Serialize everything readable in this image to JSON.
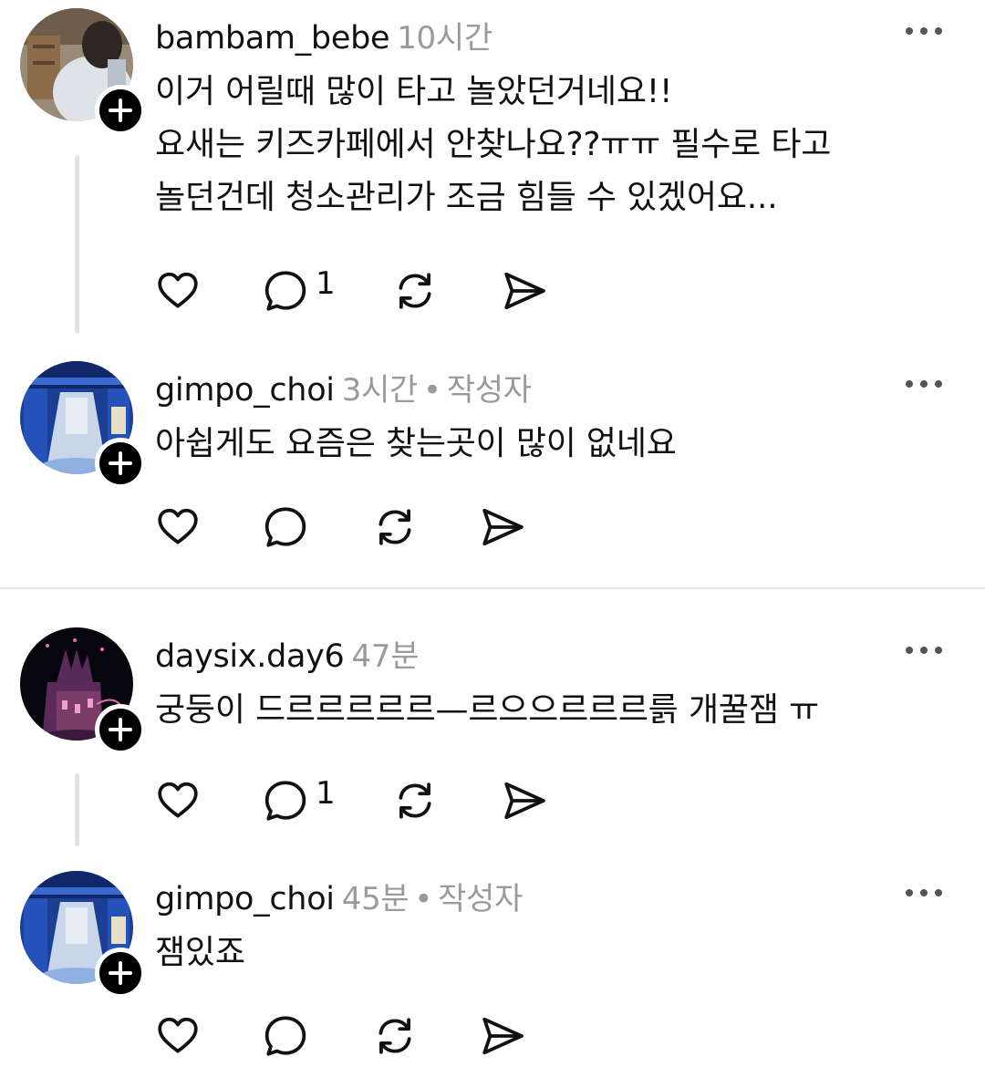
{
  "comments": [
    {
      "username": "bambam_bebe",
      "time": "10시간",
      "author_tag": "",
      "lines": [
        "이거 어릴때 많이 타고 놀았던거네요!!",
        "요새는 키즈카페에서 안찾나요??ㅠㅠ 필수로 타고",
        "놀던건데 청소관리가 조금 힘들 수 있겠어요..."
      ],
      "reply_count": "1",
      "avatar": "photo-child-avatar"
    },
    {
      "username": "gimpo_choi",
      "time": "3시간",
      "author_tag": "작성자",
      "lines": [
        "아쉽게도 요즘은 찾는곳이 많이 없네요"
      ],
      "reply_count": "",
      "avatar": "photo-blue-corridor-avatar"
    },
    {
      "username": "daysix.day6",
      "time": "47분",
      "author_tag": "",
      "lines": [
        "궁둥이 드르르르르르—르으으르르르륽 개꿀잼 ㅠ"
      ],
      "reply_count": "1",
      "avatar": "photo-night-castle-avatar"
    },
    {
      "username": "gimpo_choi",
      "time": "45분",
      "author_tag": "작성자",
      "lines": [
        "잼있죠"
      ],
      "reply_count": "",
      "avatar": "photo-blue-corridor-avatar"
    }
  ],
  "colors": {
    "text": "#111111",
    "meta": "#9a9a9a",
    "thread_line": "#e2e2e2",
    "divider": "#e6e6e6"
  },
  "icons": {
    "like": "heart-icon",
    "reply": "speech-bubble-icon",
    "repost": "repost-icon",
    "share": "send-icon",
    "more": "more-dots-icon",
    "follow": "plus-icon"
  }
}
